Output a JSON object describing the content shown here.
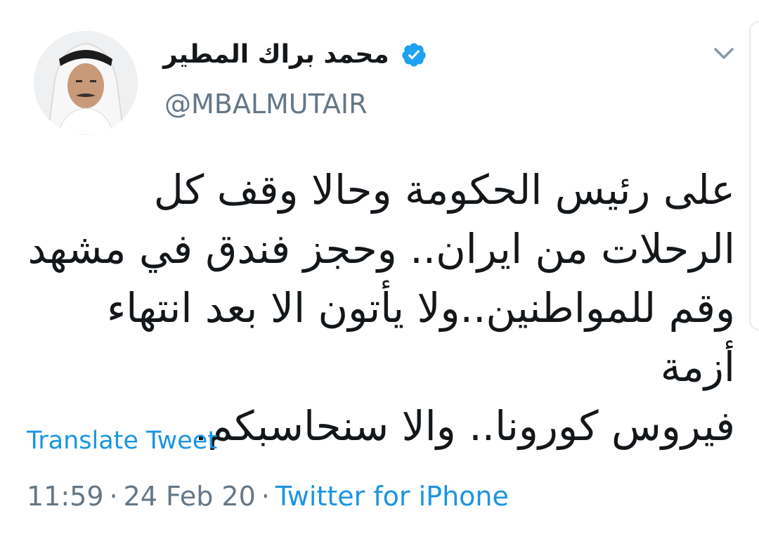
{
  "tweet": {
    "author": {
      "display_name": "محمد براك المطير",
      "handle": "@MBALMUTAIR",
      "verified": true
    },
    "text": "على رئيس الحكومة وحالا وقف كل\nالرحلات من ايران.. وحجز فندق في مشهد\nوقم للمواطنين..ولا يأتون الا بعد انتهاء أزمة\nفيروس كورونا.. والا سنحاسبكم.",
    "translate_label": "Translate Tweet",
    "time": "11:59",
    "date": "24 Feb 20",
    "separator": "·",
    "source": "Twitter for iPhone"
  },
  "colors": {
    "link": "#1b95e0",
    "muted": "#657786",
    "text": "#14171a",
    "verified": "#1da1f2"
  },
  "icons": {
    "verified": "verified-badge-icon",
    "menu": "chevron-down-icon"
  }
}
